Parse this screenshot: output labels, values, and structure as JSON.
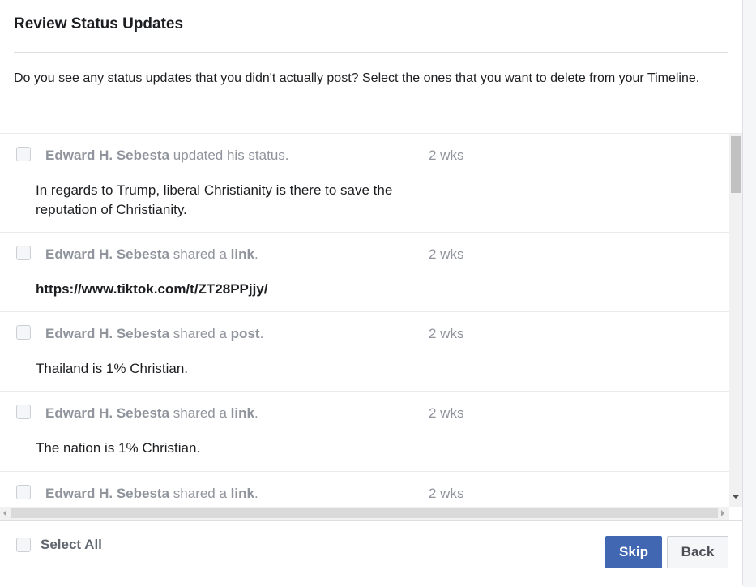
{
  "dialog": {
    "title": "Review Status Updates",
    "description": "Do you see any status updates that you didn't actually post? Select the ones that you want to delete from your Timeline."
  },
  "items": [
    {
      "author": "Edward H. Sebesta",
      "action": " updated his status.",
      "kind": "",
      "suffix": "",
      "time": "2 wks",
      "body": "In regards to Trump, liberal Christianity is there to save the reputation of Christianity.",
      "body_is_link": false
    },
    {
      "author": "Edward H. Sebesta",
      "action": " shared a ",
      "kind": "link",
      "suffix": ".",
      "time": "2 wks",
      "body": "https://www.tiktok.com/t/ZT28PPjjy/",
      "body_is_link": true
    },
    {
      "author": "Edward H. Sebesta",
      "action": " shared a ",
      "kind": "post",
      "suffix": ".",
      "time": "2 wks",
      "body": "Thailand is 1% Christian.",
      "body_is_link": false
    },
    {
      "author": "Edward H. Sebesta",
      "action": " shared a ",
      "kind": "link",
      "suffix": ".",
      "time": "2 wks",
      "body": "The nation is 1% Christian.",
      "body_is_link": false
    },
    {
      "author": "Edward H. Sebesta",
      "action": " shared a ",
      "kind": "link",
      "suffix": ".",
      "time": "2 wks",
      "body": "",
      "body_is_link": false
    }
  ],
  "footer": {
    "select_all_label": "Select All",
    "skip_label": "Skip",
    "back_label": "Back"
  },
  "colors": {
    "primary_button": "#4267b2",
    "muted_text": "#90949c",
    "body_text": "#1c1e21"
  }
}
